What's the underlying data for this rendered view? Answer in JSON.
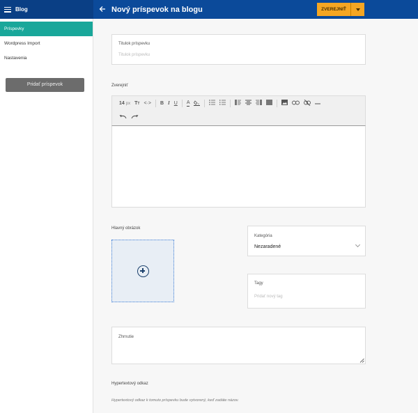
{
  "header": {
    "app_title": "Blog",
    "page_title": "Nový príspevok na blogu",
    "publish_label": "ZVEREJNIŤ"
  },
  "colors": {
    "header_bg": "#0b4a9a",
    "sidebar_active": "#19a79a",
    "publish_accent": "#f5a623"
  },
  "sidebar": {
    "items": [
      {
        "label": "Príspevky",
        "active": true
      },
      {
        "label": "Wordpress Import",
        "active": false
      },
      {
        "label": "Nastavenia",
        "active": false
      }
    ],
    "add_button_label": "Pridať príspevok"
  },
  "form": {
    "title_field": {
      "label": "Titulok príspevku",
      "placeholder": "Titulok príspevku"
    },
    "publish_section_label": "Zverejniť",
    "toolbar": {
      "font_size": "14",
      "font_unit": "px",
      "buttons": [
        "text-size-icon",
        "code-icon",
        "bold-icon",
        "italic-icon",
        "underline-icon",
        "font-color-icon",
        "fill-color-icon",
        "bullet-list-icon",
        "numbered-list-icon",
        "align-left-icon",
        "align-center-icon",
        "align-right-icon",
        "align-justify-icon",
        "image-icon",
        "link-icon",
        "unlink-icon",
        "horizontal-rule-icon",
        "undo-icon",
        "redo-icon"
      ]
    },
    "main_image_label": "Hlavný obrázok",
    "category": {
      "label": "Kategória",
      "value": "Nezaradené"
    },
    "tags": {
      "label": "Tagy",
      "placeholder": "Pridať nový tag"
    },
    "summary": {
      "label": "Zhrnutie"
    },
    "hyperlink": {
      "label": "Hypertextový odkaz",
      "hint": "Hypertextový odkaz k tomuto príspevku bude vytvorený, keď zadáte názov."
    }
  }
}
